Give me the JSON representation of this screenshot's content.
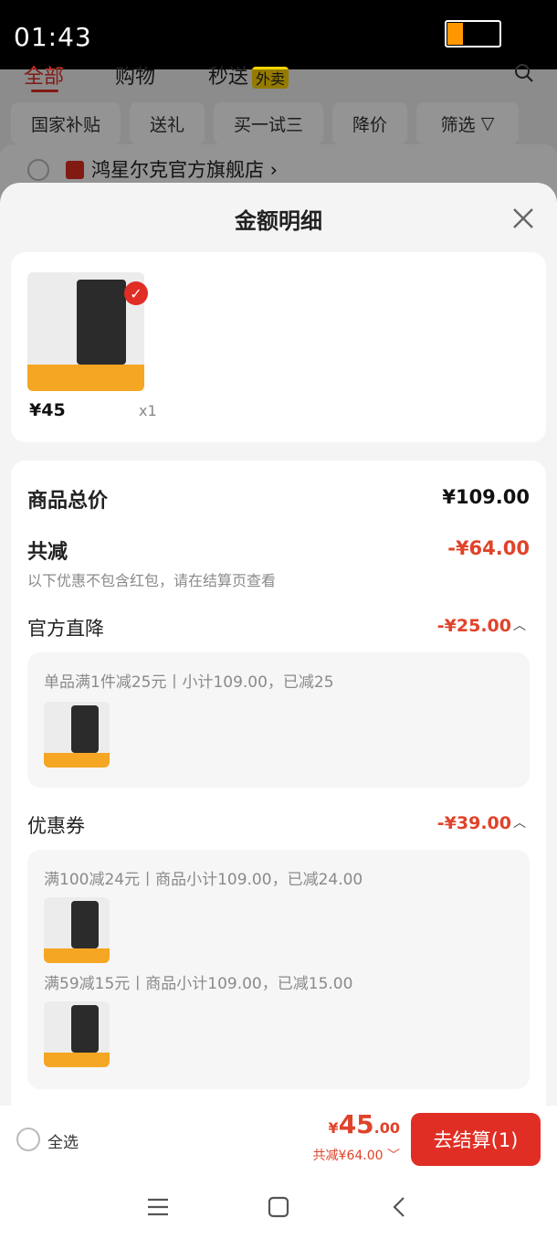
{
  "status_bar": {
    "time": "01:43",
    "battery_level": 0.3
  },
  "background": {
    "tabs": [
      {
        "label": "全部",
        "active": true
      },
      {
        "label": "购物",
        "active": false
      },
      {
        "label": "秒送",
        "active": false
      }
    ],
    "waimai_badge": "外卖",
    "chips": [
      "国家补贴",
      "送礼",
      "买一试三",
      "降价",
      "筛选"
    ],
    "store_name": "鸿星尔克官方旗舰店"
  },
  "sheet": {
    "title": "金额明细",
    "product": {
      "price": "¥45",
      "quantity": "x1"
    },
    "total_label": "商品总价",
    "total_value": "¥109.00",
    "discount_label": "共减",
    "discount_value": "-¥64.00",
    "discount_note": "以下优惠不包含红包，请在结算页查看",
    "official": {
      "label": "官方直降",
      "value": "-¥25.00",
      "details": [
        "单品满1件减25元丨小计109.00，已减25"
      ]
    },
    "coupon": {
      "label": "优惠券",
      "value": "-¥39.00",
      "details": [
        "满100减24元丨商品小计109.00，已减24.00",
        "满59减15元丨商品小计109.00，已减15.00"
      ]
    }
  },
  "bottom_bar": {
    "select_all": "全选",
    "price_yen": "¥",
    "price_int": "45",
    "price_dec": ".00",
    "saved": "共减¥64.00",
    "checkout": "去结算(1)"
  },
  "colors": {
    "accent": "#e02e24",
    "discount": "#e0432a"
  },
  "icons": [
    "close-icon",
    "chevron-up-icon",
    "chevron-down-icon",
    "search-icon",
    "menu-icon",
    "home-icon",
    "back-icon",
    "check-icon"
  ]
}
